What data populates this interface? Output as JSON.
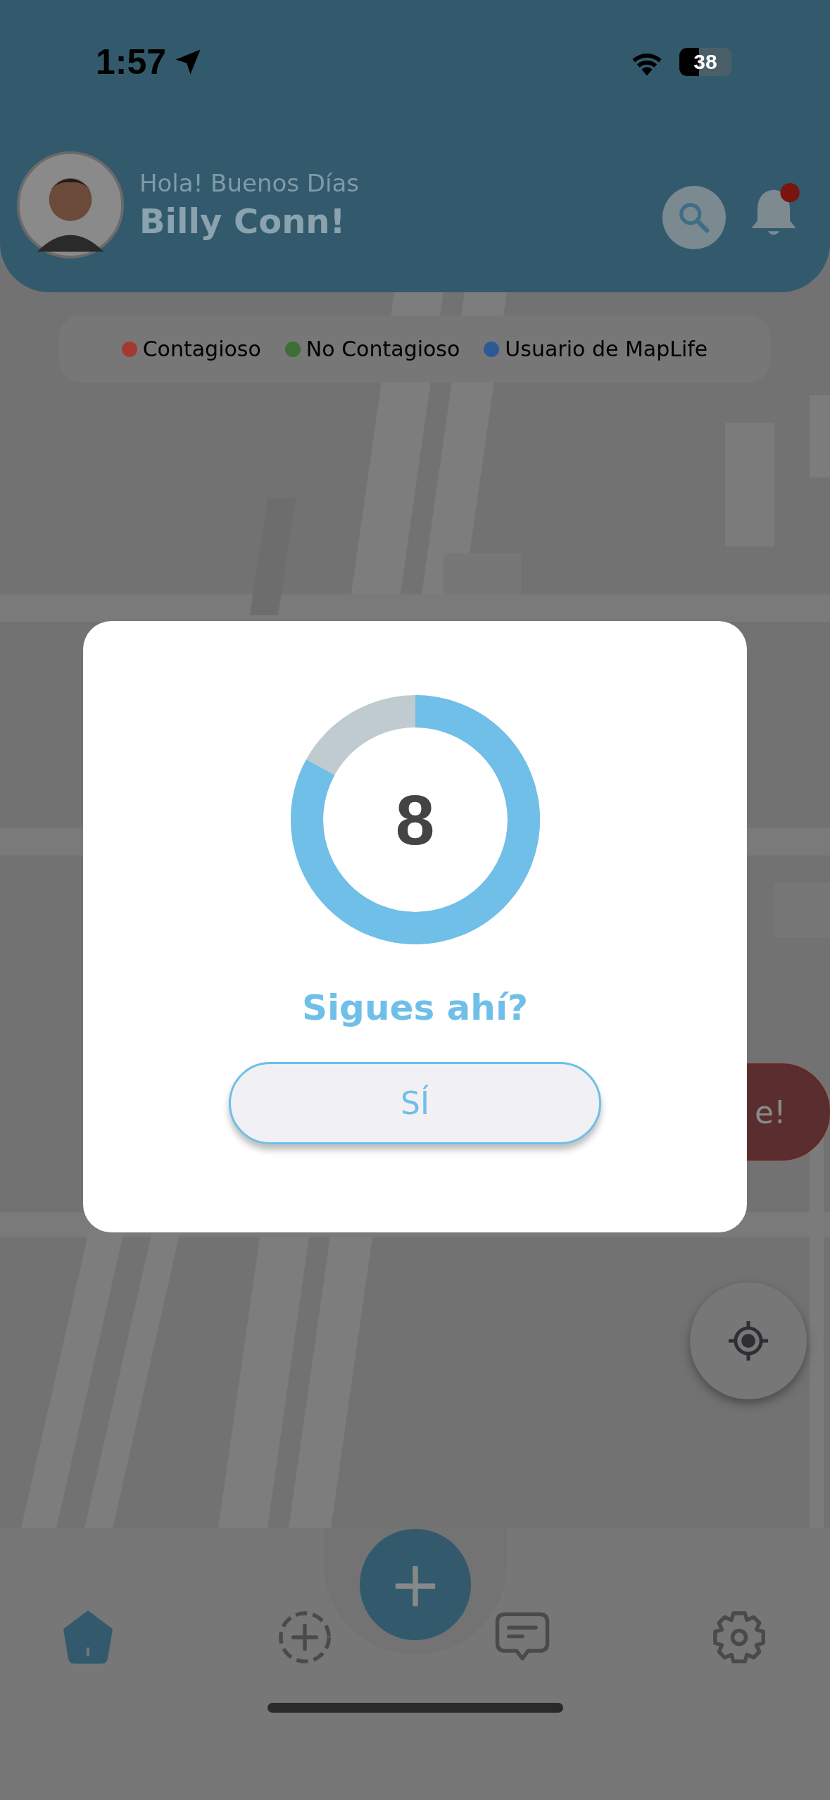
{
  "status_bar": {
    "time": "1:57",
    "battery": "38"
  },
  "header": {
    "greeting": "Hola! Buenos Días",
    "name": "Billy Conn!",
    "has_notification": true
  },
  "legend": [
    {
      "label": "Contagioso",
      "color": "#a33a2f"
    },
    {
      "label": "No Contagioso",
      "color": "#3c6e35"
    },
    {
      "label": "Usuario de MapLife",
      "color": "#2d5a95"
    }
  ],
  "alert_button": {
    "label": "e!"
  },
  "dialog": {
    "countdown": "8",
    "level": 0.83,
    "question": "Sigues ahí?",
    "button": "SÍ"
  },
  "nav": {
    "fab": "+",
    "items": [
      {
        "kind": "home",
        "selected": true
      },
      {
        "kind": "add",
        "selected": false
      },
      {
        "kind": "chat",
        "selected": false
      },
      {
        "kind": "settings",
        "selected": false
      }
    ]
  }
}
